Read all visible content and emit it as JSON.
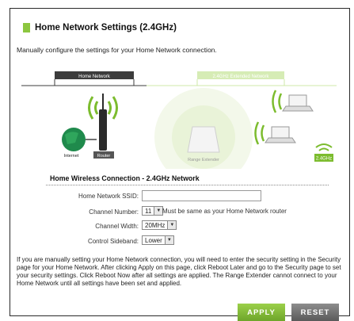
{
  "header": {
    "title": "Home Network Settings (2.4GHz)"
  },
  "intro": "Manually configure the settings for your Home Network connection.",
  "diagram": {
    "home_network_label": "Home Network",
    "extended_label": "2.4GHz Extended Network",
    "internet_label": "Internet",
    "router_label": "Router",
    "extender_label": "Range Extender",
    "badge_label": "2.4GHz",
    "colors": {
      "green": "#8cc63f",
      "dark": "#3c3c3c",
      "light_green": "#cfe8a8"
    }
  },
  "form": {
    "section_title": "Home Wireless Connection - 2.4GHz Network",
    "ssid_label": "Home Network SSID:",
    "ssid_value": "",
    "channel_number_label": "Channel Number:",
    "channel_number_value": "11",
    "channel_hint": "Must be same as your Home Network router",
    "channel_width_label": "Channel Width:",
    "channel_width_value": "20MHz",
    "sideband_label": "Control Sideband:",
    "sideband_value": "Lower"
  },
  "notice": "If you are manually setting your Home Network connection, you will need to enter the security setting in the Security page for your Home Network. After clicking Apply on this page, click Reboot Later and go to the Security page to set your security settings. Click Reboot Now after all settings are applied. The Range Extender cannot connect to your Home Network until all settings have been set and applied.",
  "buttons": {
    "apply": "APPLY",
    "reset": "RESET"
  }
}
